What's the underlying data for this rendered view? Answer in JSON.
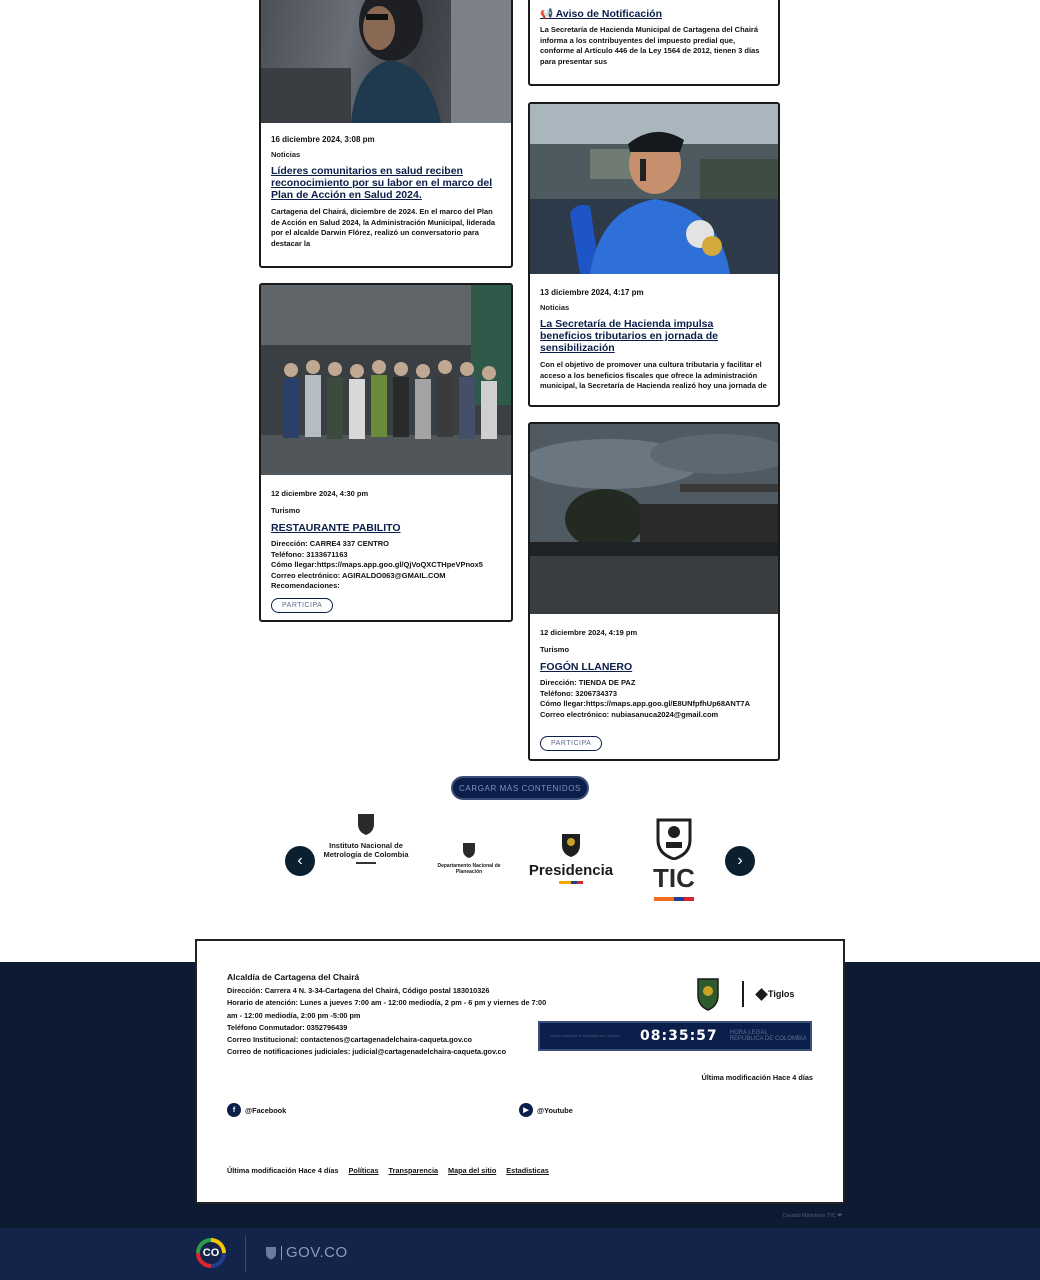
{
  "cards": {
    "notice": {
      "title": "📢 Aviso de Notificación",
      "excerpt": "La Secretaría de Hacienda Municipal de Cartagena del Chairá informa a los contribuyentes del impuesto predial que, conforme al Artículo 446 de la Ley 1564 de 2012, tienen 3 días para presentar sus"
    },
    "lideres": {
      "date": "16 diciembre 2024, 3:08 pm",
      "category": "Noticias",
      "title": "Líderes comunitarios en salud reciben reconocimiento por su labor en el marco del Plan de Acción en Salud 2024.",
      "excerpt": "Cartagena del Chairá, diciembre de 2024. En el marco del Plan de Acción en Salud 2024, la Administración Municipal, liderada por el alcalde Darwin Flórez, realizó un conversatorio para destacar la"
    },
    "hacienda": {
      "date": "13 diciembre 2024, 4:17 pm",
      "category": "Noticias",
      "title": "La Secretaría de Hacienda impulsa beneficios tributarios en jornada de sensibilización",
      "excerpt": "Con el objetivo de promover una cultura tributaria y facilitar el acceso a los beneficios fiscales que ofrece la administración municipal, la Secretaría de Hacienda realizó hoy una jornada de"
    },
    "pabilito": {
      "date": "12 diciembre 2024, 4:30 pm",
      "category": "Turismo",
      "title": "RESTAURANTE PABILITO",
      "lines": [
        "Dirección: CARRE4 337 CENTRO",
        "Teléfono: 3133671163",
        "Cómo llegar:https://maps.app.goo.gl/QjVoQXCTHpeVPnox5",
        "Correo electrónico: AGIRALDO063@GMAIL.COM",
        "Recomendaciones:"
      ],
      "button": "PARTICIPA"
    },
    "fogon": {
      "date": "12 diciembre 2024, 4:19 pm",
      "category": "Turismo",
      "title": "FOGÓN LLANERO",
      "lines": [
        "Dirección: TIENDA DE PAZ",
        "Teléfono: 3206734373",
        "Cómo llegar:https://maps.app.goo.gl/E8UNfpfhUp68ANT7A",
        "Correo electrónico: nubiasanuca2024@gmail.com"
      ],
      "button": "PARTICIPA"
    }
  },
  "load_more": "CARGAR MÁS CONTENIDOS",
  "logos": {
    "metrologia": "Instituto Nacional de Metrología de Colombia",
    "planeacion": "Departamento Nacional de Planeación",
    "presidencia": "Presidencia",
    "tic": "TIC"
  },
  "footer": {
    "entity": "Alcaldía de Cartagena del Chairá",
    "address": "Dirección: Carrera 4 N. 3-34-Cartagena del Chairá, Código postal 183010326",
    "hours_1": "Horario de atención: Lunes a jueves 7:00 am - 12:00 mediodía, 2 pm - 6 pm y viernes de 7:00",
    "hours_2": "am - 12:00 mediodía, 2:00 pm -5:00 pm",
    "phone": "Teléfono Conmutador: 0352796439",
    "email": "Correo Institucional: contactenos@cartagenadelchaira-caqueta.gov.co",
    "email_judicial": "Correo de notificaciones judiciales: judicial@cartagenadelchaira-caqueta.gov.co",
    "last_modified_right": "Última modificación Hace 4 días",
    "facebook": "@Facebook",
    "youtube": "@Youtube",
    "last_modified": "Última modificación Hace 4 días",
    "links": [
      "Políticas",
      "Transparencia",
      "Mapa del sitio",
      "Estadísticas"
    ],
    "clock_time": "08:35:57",
    "clock_label_1": "HORA LEGAL",
    "clock_label_2": "REPÚBLICA DE COLOMBIA",
    "clock_small": "Instituto Nacional de Metrología de Colombia",
    "tiglos": "Tiglos",
    "credit": "Creado Ministerio TIC ❤"
  },
  "govbar": {
    "co": "CO",
    "gov": "GOV.CO"
  }
}
